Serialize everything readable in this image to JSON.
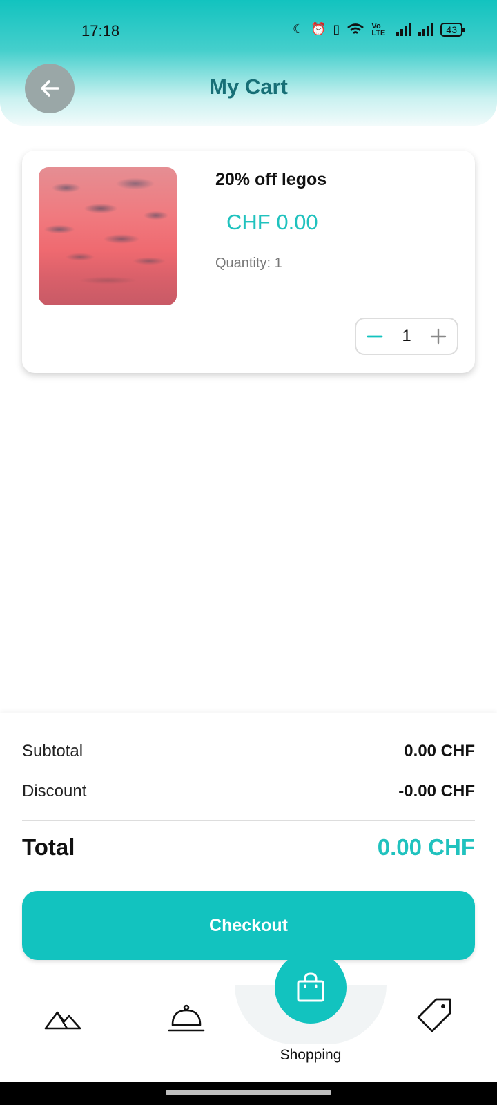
{
  "status_bar": {
    "time": "17:18",
    "network": "Vo LTE",
    "battery": "43"
  },
  "header": {
    "title": "My Cart",
    "back_icon": "arrow-left-icon"
  },
  "cart": {
    "items": [
      {
        "name": "20% off legos",
        "price": "CHF 0.00",
        "quantity_label": "Quantity: 1",
        "quantity": "1"
      }
    ]
  },
  "summary": {
    "subtotal_label": "Subtotal",
    "subtotal_value": "0.00 CHF",
    "discount_label": "Discount",
    "discount_value": "-0.00 CHF",
    "total_label": "Total",
    "total_value": "0.00 CHF",
    "checkout_label": "Checkout"
  },
  "nav": {
    "items": [
      {
        "icon": "mountain-icon"
      },
      {
        "icon": "service-bell-icon"
      },
      {
        "icon": "shopping-bag-icon",
        "label": "Shopping",
        "active": true
      },
      {
        "icon": "tag-icon"
      }
    ]
  },
  "colors": {
    "accent": "#12c3bf",
    "title": "#176f76",
    "price": "#20c2be"
  }
}
